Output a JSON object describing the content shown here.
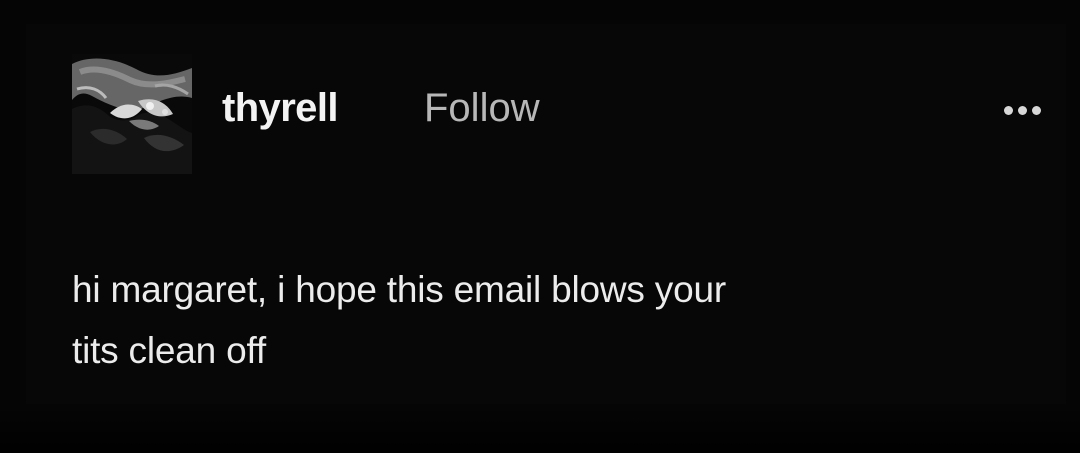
{
  "post": {
    "author": {
      "username": "thyrell",
      "follow_label": "Follow",
      "avatar_icon": "avatar-photo-icon"
    },
    "menu": {
      "more_icon": "more-options-icon"
    },
    "body": {
      "line1": "hi margaret, i hope this email blows your",
      "line2": "tits clean off"
    }
  },
  "theme": {
    "background": "#000000",
    "card": "#070707",
    "username_color": "#f3f3f3",
    "follow_color": "#b7b7b7",
    "text_color": "#ececec",
    "dots_color": "#d7d7d7"
  }
}
